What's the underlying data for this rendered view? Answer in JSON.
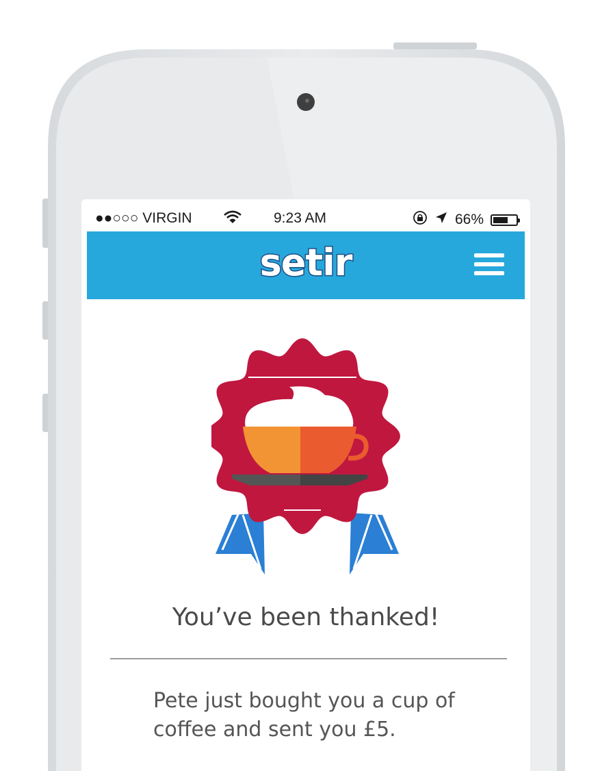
{
  "status_bar": {
    "carrier": "●●○○○ VIRGIN",
    "time": "9:23 AM",
    "battery_percent": "66%",
    "battery_level": 0.66
  },
  "header": {
    "logo_text": "setir",
    "menu_icon": "hamburger-menu-icon",
    "background": "#27a8dc"
  },
  "badge": {
    "icon": "coffee-cup-award-icon",
    "colors": {
      "rosette": "#c0173f",
      "ribbon": "#2b7fd4",
      "cup_left": "#f39434",
      "cup_right": "#ea5b2f",
      "saucer": "#555555"
    }
  },
  "content": {
    "headline": "You’ve been thanked!",
    "message": "Pete just bought you a cup of coffee and sent you £5."
  }
}
